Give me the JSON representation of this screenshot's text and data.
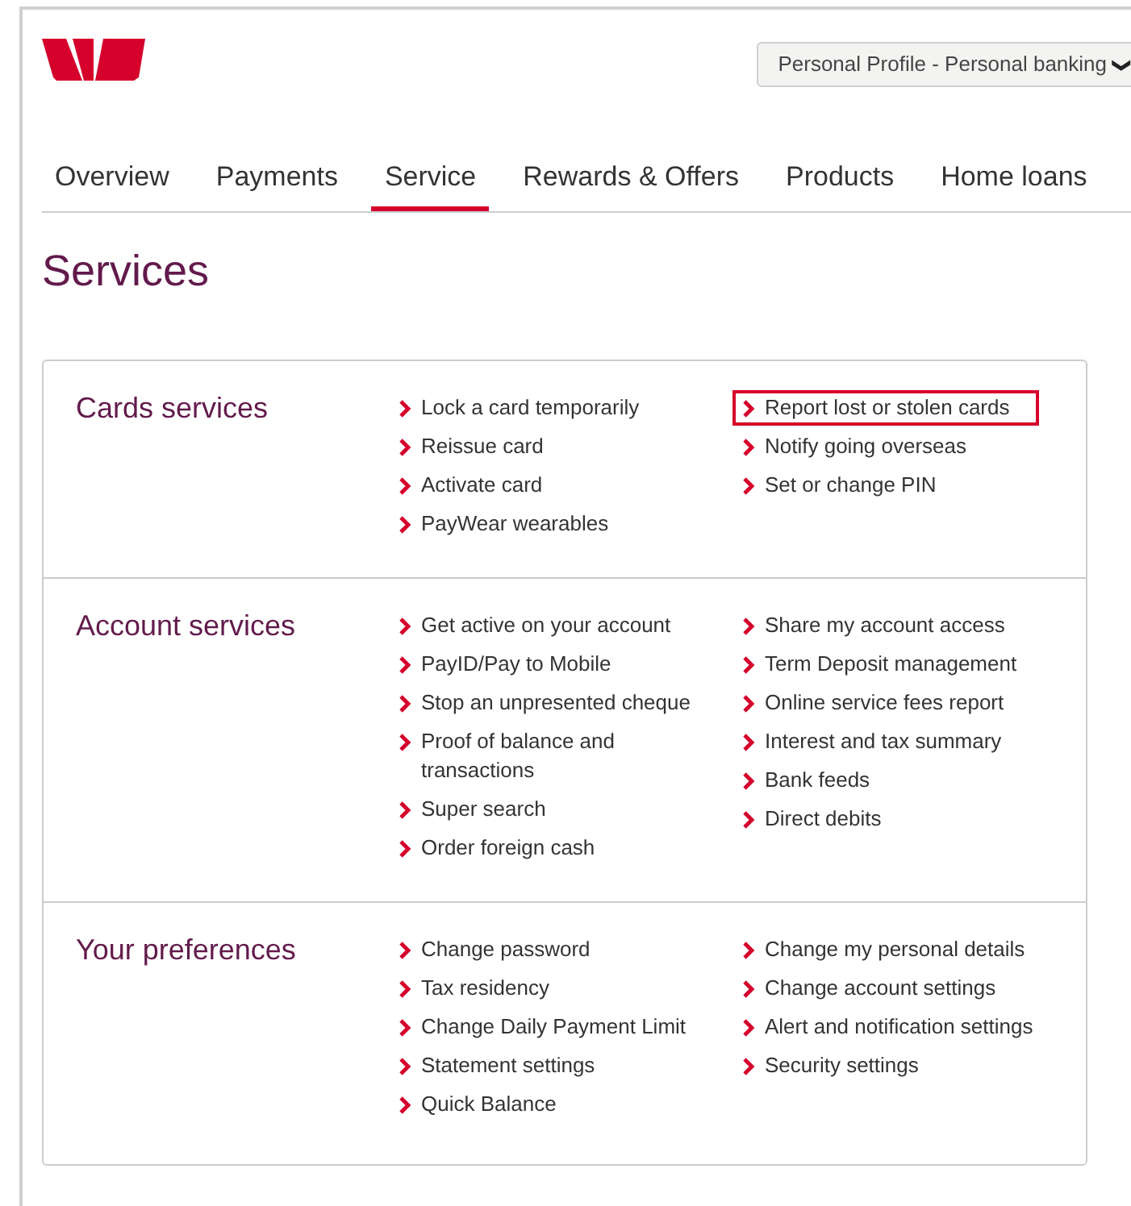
{
  "header": {
    "profile_menu": {
      "label": "Personal Profile - Personal banking",
      "caret": "❯"
    }
  },
  "tabs": [
    {
      "label": "Overview",
      "selected": false
    },
    {
      "label": "Payments",
      "selected": false
    },
    {
      "label": "Service",
      "selected": true
    },
    {
      "label": "Rewards & Offers",
      "selected": false
    },
    {
      "label": "Products",
      "selected": false
    },
    {
      "label": "Home loans",
      "selected": false
    }
  ],
  "page_title": "Services",
  "sections": [
    {
      "title": "Cards services",
      "columns": [
        [
          {
            "label": "Lock a card temporarily",
            "highlighted": false
          },
          {
            "label": "Reissue card",
            "highlighted": false
          },
          {
            "label": "Activate card",
            "highlighted": false
          },
          {
            "label": "PayWear wearables",
            "highlighted": false
          }
        ],
        [
          {
            "label": "Report lost or stolen cards",
            "highlighted": true
          },
          {
            "label": "Notify going overseas",
            "highlighted": false
          },
          {
            "label": "Set or change PIN",
            "highlighted": false
          }
        ]
      ]
    },
    {
      "title": "Account services",
      "columns": [
        [
          {
            "label": "Get active on your account",
            "highlighted": false
          },
          {
            "label": "PayID/Pay to Mobile",
            "highlighted": false
          },
          {
            "label": "Stop an unpresented cheque",
            "highlighted": false
          },
          {
            "label": "Proof of balance and transactions",
            "highlighted": false
          },
          {
            "label": "Super search",
            "highlighted": false
          },
          {
            "label": "Order foreign cash",
            "highlighted": false
          }
        ],
        [
          {
            "label": "Share my account access",
            "highlighted": false
          },
          {
            "label": "Term Deposit management",
            "highlighted": false
          },
          {
            "label": "Online service fees report",
            "highlighted": false
          },
          {
            "label": "Interest and tax summary",
            "highlighted": false
          },
          {
            "label": "Bank feeds",
            "highlighted": false
          },
          {
            "label": "Direct debits",
            "highlighted": false
          }
        ]
      ]
    },
    {
      "title": "Your preferences",
      "columns": [
        [
          {
            "label": "Change password",
            "highlighted": false
          },
          {
            "label": "Tax residency",
            "highlighted": false
          },
          {
            "label": "Change Daily Payment Limit",
            "highlighted": false
          },
          {
            "label": "Statement settings",
            "highlighted": false
          },
          {
            "label": "Quick Balance",
            "highlighted": false
          }
        ],
        [
          {
            "label": "Change my personal details",
            "highlighted": false
          },
          {
            "label": "Change account settings",
            "highlighted": false
          },
          {
            "label": "Alert and notification settings",
            "highlighted": false
          },
          {
            "label": "Security settings",
            "highlighted": false
          }
        ]
      ]
    }
  ]
}
